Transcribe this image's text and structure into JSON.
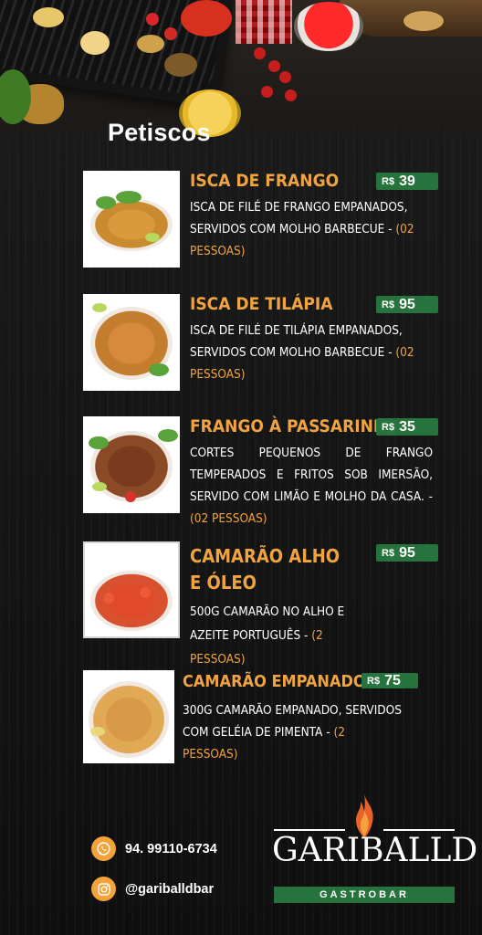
{
  "heading": "Petiscos",
  "items": [
    {
      "title": "ISCA DE FRANGO",
      "currency": "R$",
      "price": "39",
      "description": "ISCA DE FILÉ DE FRANGO EMPANADOS, SERVIDOS COM MOLHO BARBECUE",
      "separator": " - ",
      "serves": "(02 PESSOAS)",
      "image": "breaded-chicken-strips-photo"
    },
    {
      "title": "ISCA DE TILÁPIA",
      "currency": "R$",
      "price": "95",
      "description": "ISCA DE FILÉ DE TILÁPIA EMPANADOS, SERVIDOS COM MOLHO BARBECUE",
      "separator": " - ",
      "serves": "(02 PESSOAS)",
      "image": "breaded-tilapia-strips-photo"
    },
    {
      "title": "FRANGO À PASSARINHO",
      "currency": "R$",
      "price": "35",
      "description": "CORTES PEQUENOS DE FRANGO TEMPERADOS E FRITOS SOB IMERSÃO, SERVIDO COM LIMÃO E MOLHO DA CASA.",
      "separator": " - ",
      "serves": "(02 PESSOAS)",
      "image": "fried-chicken-pieces-photo"
    },
    {
      "title_line1": "CAMARÃO ALHO",
      "title_line2": "E ÓLEO",
      "currency": "R$",
      "price": "95",
      "description": "500G CAMARÃO NO ALHO E AZEITE PORTUGUÊS",
      "separator": " - ",
      "serves": "(2 PESSOAS)",
      "image": "garlic-shrimp-photo"
    },
    {
      "title": "CAMARÃO EMPANADO",
      "currency": "R$",
      "price": "75",
      "description": "300G CAMARÃO EMPANADO, SERVIDOS COM GELÉIA DE PIMENTA",
      "separator": " - ",
      "serves": "(2 PESSOAS)",
      "image": "breaded-shrimp-photo"
    }
  ],
  "contact": {
    "phone": "94. 99110-6734",
    "phone_icon": "whatsapp-icon",
    "instagram": "@gariballdbar",
    "instagram_icon": "instagram-icon"
  },
  "logo": {
    "name": "GARIBALLD",
    "tagline": "GASTROBAR",
    "icon": "flame-icon"
  },
  "colors": {
    "accent_orange": "#f0a341",
    "price_green": "#27733d",
    "background": "#151515",
    "icon_orange": "#f4a23a"
  }
}
